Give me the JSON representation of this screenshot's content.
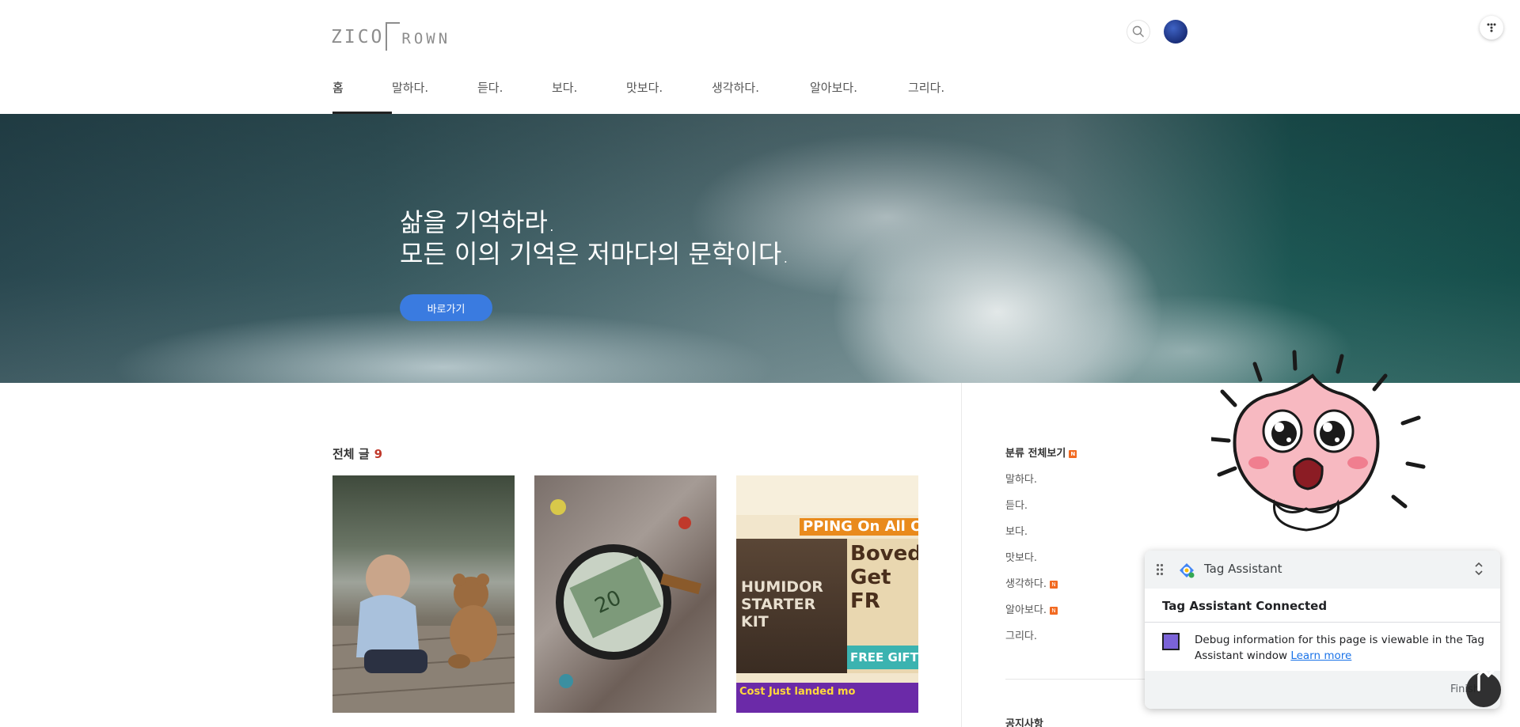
{
  "header": {
    "logo": {
      "part1": "ZICO",
      "part2": "ROWN"
    }
  },
  "nav": {
    "items": [
      {
        "label": "홈",
        "active": true
      },
      {
        "label": "말하다."
      },
      {
        "label": "듣다."
      },
      {
        "label": "보다."
      },
      {
        "label": "맛보다."
      },
      {
        "label": "생각하다."
      },
      {
        "label": "알아보다."
      },
      {
        "label": "그리다."
      }
    ]
  },
  "hero": {
    "line1": "삶을 기억하라.",
    "line2": "모든 이의 기억은 저마다의 문학이다.",
    "button_label": "바로가기"
  },
  "posts": {
    "heading": "전체 글",
    "count": "9",
    "thumb3": {
      "orange_text": "PPING On All Orders Over $",
      "bag_text": "HUMIDOR STARTER KIT",
      "right_text": "Boved Get FR",
      "teal_text": "FREE GIFT",
      "purple_text": "Cost Just landed mo"
    }
  },
  "sidebar": {
    "category_title": "분류 전체보기",
    "new_badge": "N",
    "categories": [
      {
        "label": "말하다."
      },
      {
        "label": "듣다."
      },
      {
        "label": "보다."
      },
      {
        "label": "맛보다."
      },
      {
        "label": "생각하다.",
        "new": true
      },
      {
        "label": "알아보다.",
        "new": true
      },
      {
        "label": "그리다."
      }
    ],
    "notice_title": "공지사항"
  },
  "tag_assistant": {
    "title": "Tag Assistant",
    "status": "Tag Assistant Connected",
    "message": "Debug information for this page is viewable in the Tag Assistant window",
    "link": "Learn more",
    "finish": "Finish",
    "swatch_color": "#7b63d8"
  },
  "colors": {
    "accent": "#3a7be0",
    "count": "#c0392b",
    "new_badge": "#f26a21"
  }
}
